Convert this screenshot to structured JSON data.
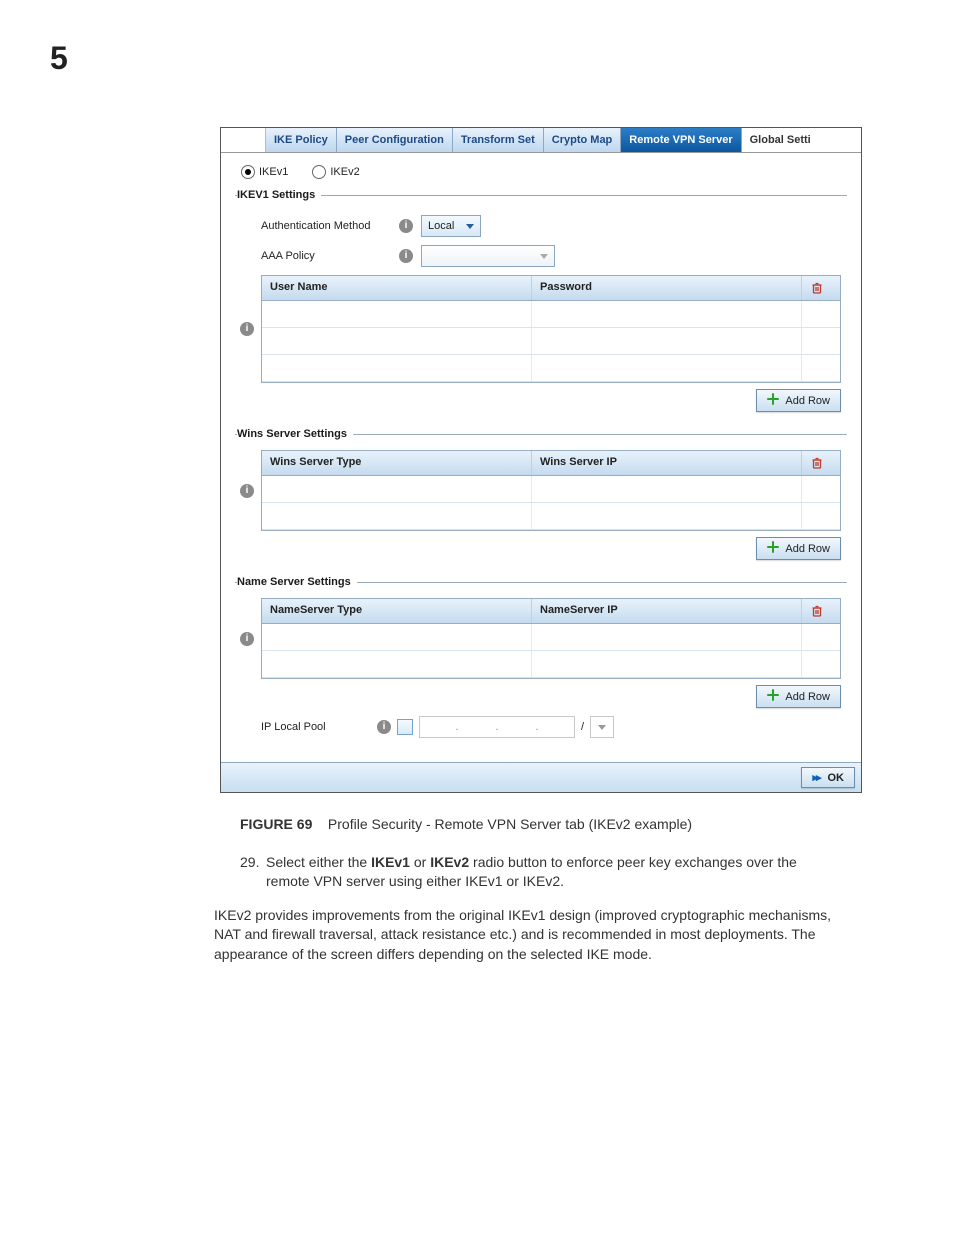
{
  "page_number": "5",
  "tabs": {
    "ike_policy": "IKE Policy",
    "peer_config": "Peer Configuration",
    "transform_set": "Transform Set",
    "crypto_map": "Crypto Map",
    "remote_vpn": "Remote VPN Server",
    "global_settings": "Global Setti"
  },
  "radios": {
    "ikev1": "IKEv1",
    "ikev2": "IKEv2"
  },
  "sections": {
    "ikev1_settings": "IKEV1 Settings",
    "wins_settings": "Wins Server Settings",
    "name_settings": "Name Server Settings"
  },
  "fields": {
    "auth_method_label": "Authentication Method",
    "auth_method_value": "Local",
    "aaa_policy_label": "AAA Policy",
    "ip_local_pool_label": "IP Local Pool"
  },
  "tables": {
    "users": {
      "col1": "User Name",
      "col2": "Password"
    },
    "wins": {
      "col1": "Wins Server Type",
      "col2": "Wins Server IP"
    },
    "name": {
      "col1": "NameServer Type",
      "col2": "NameServer IP"
    }
  },
  "buttons": {
    "add_row": "Add Row",
    "ok": "OK"
  },
  "ip_input": {
    "dot": ".",
    "slash": "/"
  },
  "figure": {
    "label": "FIGURE 69",
    "caption": "Profile Security - Remote VPN Server tab (IKEv2 example)"
  },
  "step": {
    "num": "29.",
    "pre": "Select either the ",
    "b1": "IKEv1",
    "mid": " or ",
    "b2": "IKEv2",
    "post": " radio button to enforce peer key exchanges over the remote VPN server using either IKEv1 or IKEv2."
  },
  "paragraph": "IKEv2 provides improvements from the original IKEv1 design (improved cryptographic mechanisms, NAT and firewall traversal, attack resistance etc.) and is recommended in most deployments. The appearance of the screen differs depending on the selected IKE mode."
}
